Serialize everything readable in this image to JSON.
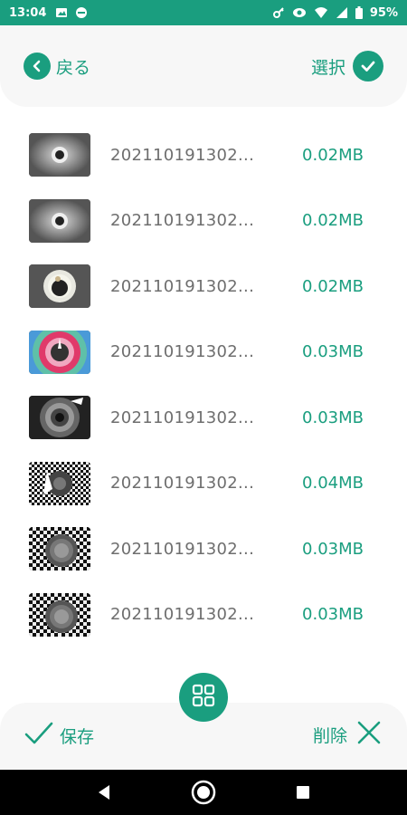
{
  "status_bar": {
    "time": "13:04",
    "battery": "95%",
    "icons_left": [
      "image-icon",
      "dnd-icon"
    ],
    "icons_right": [
      "key-icon",
      "eye-icon",
      "wifi-icon",
      "signal-icon",
      "battery-icon"
    ]
  },
  "header": {
    "back_label": "戻る",
    "select_label": "選択"
  },
  "files": [
    {
      "name": "202110191302...",
      "size": "0.02MB",
      "thumb": "gray-ring"
    },
    {
      "name": "202110191302...",
      "size": "0.02MB",
      "thumb": "gray-ring"
    },
    {
      "name": "202110191302...",
      "size": "0.02MB",
      "thumb": "white-ring"
    },
    {
      "name": "202110191302...",
      "size": "0.03MB",
      "thumb": "rainbow-ring"
    },
    {
      "name": "202110191302...",
      "size": "0.03MB",
      "thumb": "dark-ring"
    },
    {
      "name": "202110191302...",
      "size": "0.04MB",
      "thumb": "checker-spiral"
    },
    {
      "name": "202110191302...",
      "size": "0.03MB",
      "thumb": "checker-round"
    },
    {
      "name": "202110191302...",
      "size": "0.03MB",
      "thumb": "checker-round"
    }
  ],
  "bottom": {
    "save_label": "保存",
    "delete_label": "削除"
  },
  "colors": {
    "accent": "#1a9e7f",
    "text_gray": "#6e6e6e",
    "panel_bg": "#f7f7f7"
  }
}
